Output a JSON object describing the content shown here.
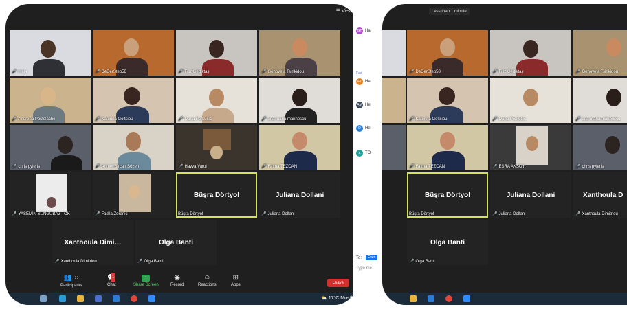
{
  "left": {
    "view_label": "View",
    "tiles": [
      {
        "name": "maja",
        "bg": "#d9dbe0"
      },
      {
        "name": "DeDerStep58",
        "bg": "#b86a2e"
      },
      {
        "name": "Filiz Gediktaş",
        "bg": "#c8c4bf"
      },
      {
        "name": "Genovefa Tsirikidou",
        "bg": "#a89270"
      },
      {
        "name": "Andreea Postolache",
        "bg": "#cbb38d"
      },
      {
        "name": "Katerina Goltsiou",
        "bg": "#d4c4b0"
      },
      {
        "name": "Ivana Perkušić",
        "bg": "#e6e2da"
      },
      {
        "name": "ana maria marinescu",
        "bg": "#e0dcd8"
      },
      {
        "name": "chris pyleris",
        "bg": "#5a5f6a"
      },
      {
        "name": "Ahmet Bircan Sözeri",
        "bg": "#d9d2c7"
      },
      {
        "name": "Havva Varol",
        "bg": "#3b342c"
      },
      {
        "name": "Fatma TEZCAN",
        "bg": "#d2c7a5"
      },
      {
        "name": "YASEMİN SÜNGÜBAZ TOK",
        "bg": "#ececec"
      },
      {
        "name": "Fadila Zoranic",
        "bg": "#c9b79e"
      }
    ],
    "name_tiles": [
      {
        "big": "Büşra Dörtyol",
        "name": "Büşra Dörtyol"
      },
      {
        "big": "Juliana  Dollani",
        "name": "Juliana  Dollani"
      },
      {
        "big": "Xanthoula  Dimi…",
        "name": "Xanthoula Dimitriou"
      },
      {
        "big": "Olga Banti",
        "name": "Olga Banti"
      }
    ],
    "toolbar": {
      "participants_label": "Participants",
      "participants_count": "22",
      "chat_label": "Chat",
      "chat_badge": "1",
      "share_label": "Share Screen",
      "record_label": "Record",
      "reactions_label": "Reactions",
      "apps_label": "Apps",
      "leave_label": "Leave"
    },
    "weather": "17°C  Mostl"
  },
  "chat": {
    "rows": [
      {
        "initials": "GT",
        "color": "#b04cd0",
        "text": "Ha",
        "sub": "Ge"
      },
      {
        "initials": "FZ",
        "color": "#e8801f",
        "text": "He",
        "sub": "Fad"
      },
      {
        "initials": "AM",
        "color": "#3c4a5c",
        "text": "He",
        "sub": "ana"
      },
      {
        "initials": "D",
        "color": "#2a7fd4",
        "text": "He",
        "sub": "Del"
      },
      {
        "initials": "a",
        "color": "#1fa39a",
        "text": "TÖ",
        "sub": "Kat"
      }
    ],
    "to_label": "To:",
    "to_value": "Even",
    "type_placeholder": "Type me"
  },
  "right": {
    "timer": "Less than 1 minute",
    "tiles": [
      {
        "name": "",
        "bg": "#d9dbe0"
      },
      {
        "name": "DeDerStep58",
        "bg": "#b86a2e"
      },
      {
        "name": "Filiz Gediktaş",
        "bg": "#c8c4bf"
      },
      {
        "name": "Genovefa Tsirikidou",
        "bg": "#a89270"
      },
      {
        "name": "",
        "bg": "#cbb38d"
      },
      {
        "name": "Katerina Goltsiou",
        "bg": "#d4c4b0"
      },
      {
        "name": "Ivana Perkušić",
        "bg": "#e6e2da"
      },
      {
        "name": "ana maria marinescu",
        "bg": "#e0dcd8"
      },
      {
        "name": "",
        "bg": "#5a5f6a"
      },
      {
        "name": "Fatma TEZCAN",
        "bg": "#d2c7a5"
      },
      {
        "name": "ESRA AKSOY",
        "bg": "#3a3a3a"
      },
      {
        "name": "chris pyleris",
        "bg": "#5a5f6a"
      }
    ],
    "name_tiles": [
      {
        "big": "Büşra Dörtyol",
        "name": "Büşra Dörtyol"
      },
      {
        "big": "Juliana  Dollani",
        "name": "Juliana  Dollani"
      },
      {
        "big": "Xanthoula  D",
        "name": "Xanthoula Dimitriou"
      },
      {
        "big": "Olga Banti",
        "name": "Olga Banti"
      }
    ]
  }
}
